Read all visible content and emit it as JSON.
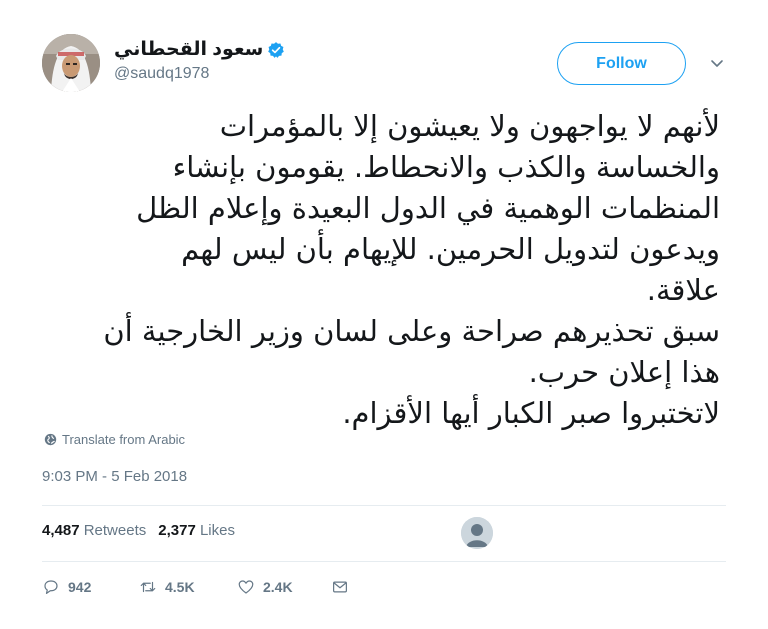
{
  "user": {
    "display_name": "سعود القحطاني",
    "handle": "@saudq1978",
    "avatar": "avatar-photo",
    "verified_icon": "verified-badge-icon"
  },
  "follow_label": "Follow",
  "tweet_lines": [
    "لأنهم لا يواجهون ولا يعيشون إلا بالمؤمرات",
    "والخساسة والكذب والانحطاط. يقومون بإنشاء",
    "المنظمات الوهمية في الدول البعيدة وإعلام الظل",
    "ويدعون لتدويل الحرمين. للإيهام بأن ليس لهم",
    "علاقة.",
    "سبق تحذيرهم صراحة وعلى لسان وزير الخارجية أن",
    "هذا إعلان حرب.",
    "لاتختبروا صبر الكبار أيها الأقزام."
  ],
  "translate_label": "Translate from Arabic",
  "timestamp": "9:03 PM - 5 Feb 2018",
  "stats": {
    "retweets_count": "4,487",
    "retweets_label": "Retweets",
    "likes_count": "2,377",
    "likes_label": "Likes"
  },
  "actions": {
    "replies": "942",
    "retweets": "4.5K",
    "likes": "2.4K"
  },
  "colors": {
    "accent": "#1da1f2",
    "secondary_text": "#657786",
    "divider": "#e6ecf0"
  }
}
